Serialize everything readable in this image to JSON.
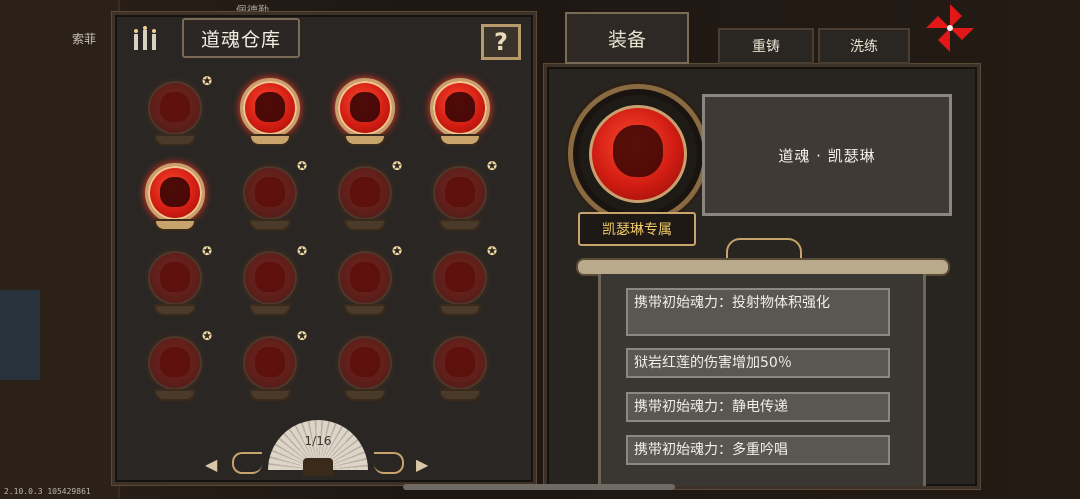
{
  "background": {
    "name_label": "索菲",
    "name_label2": "佩德勤"
  },
  "version": "2.10.0.3 105429861",
  "warehouse": {
    "title": "道魂仓库",
    "help_label": "?",
    "orbs": [
      {
        "state": "dim",
        "star": true
      },
      {
        "state": "active",
        "star": false
      },
      {
        "state": "active",
        "star": false
      },
      {
        "state": "active",
        "star": false
      },
      {
        "state": "active",
        "star": false
      },
      {
        "state": "dim",
        "star": true
      },
      {
        "state": "dim",
        "star": true
      },
      {
        "state": "dim",
        "star": true
      },
      {
        "state": "dim",
        "star": true
      },
      {
        "state": "dim",
        "star": true
      },
      {
        "state": "dim",
        "star": true
      },
      {
        "state": "dim",
        "star": true
      },
      {
        "state": "dim",
        "star": true
      },
      {
        "state": "dim",
        "star": true
      },
      {
        "state": "dim",
        "star": false
      },
      {
        "state": "dim",
        "star": false
      }
    ],
    "star_glyph": "✪",
    "pager": {
      "current": "1/16",
      "prev": "◀",
      "next": "▶"
    }
  },
  "tabs": {
    "equip": "装备",
    "reforge": "重铸",
    "refine": "洗练"
  },
  "detail": {
    "name": "道魂 · 凯瑟琳",
    "exclusive": "凯瑟琳专属",
    "effects": [
      "携带初始魂力：投射物体积强化",
      "狱岩红莲的伤害增加50％",
      "携带初始魂力：静电传递",
      "携带初始魂力：多重吟唱"
    ]
  },
  "colors": {
    "accent_red": "#d01c12",
    "gold": "#c8a46c"
  }
}
